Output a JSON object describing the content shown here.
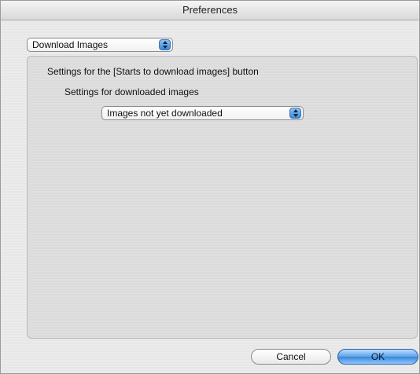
{
  "window": {
    "title": "Preferences"
  },
  "category_popup": {
    "selected": "Download Images"
  },
  "group": {
    "section_label": "Settings for the [Starts to download images] button",
    "subsection_label": "Settings for downloaded images",
    "images_popup": {
      "selected": "Images not yet downloaded"
    }
  },
  "buttons": {
    "cancel": "Cancel",
    "ok": "OK"
  },
  "icons": {
    "popup_arrows": "up-down-arrows-icon"
  },
  "colors": {
    "accent": "#3b87d6",
    "ok_button": "#5aa3ea"
  }
}
